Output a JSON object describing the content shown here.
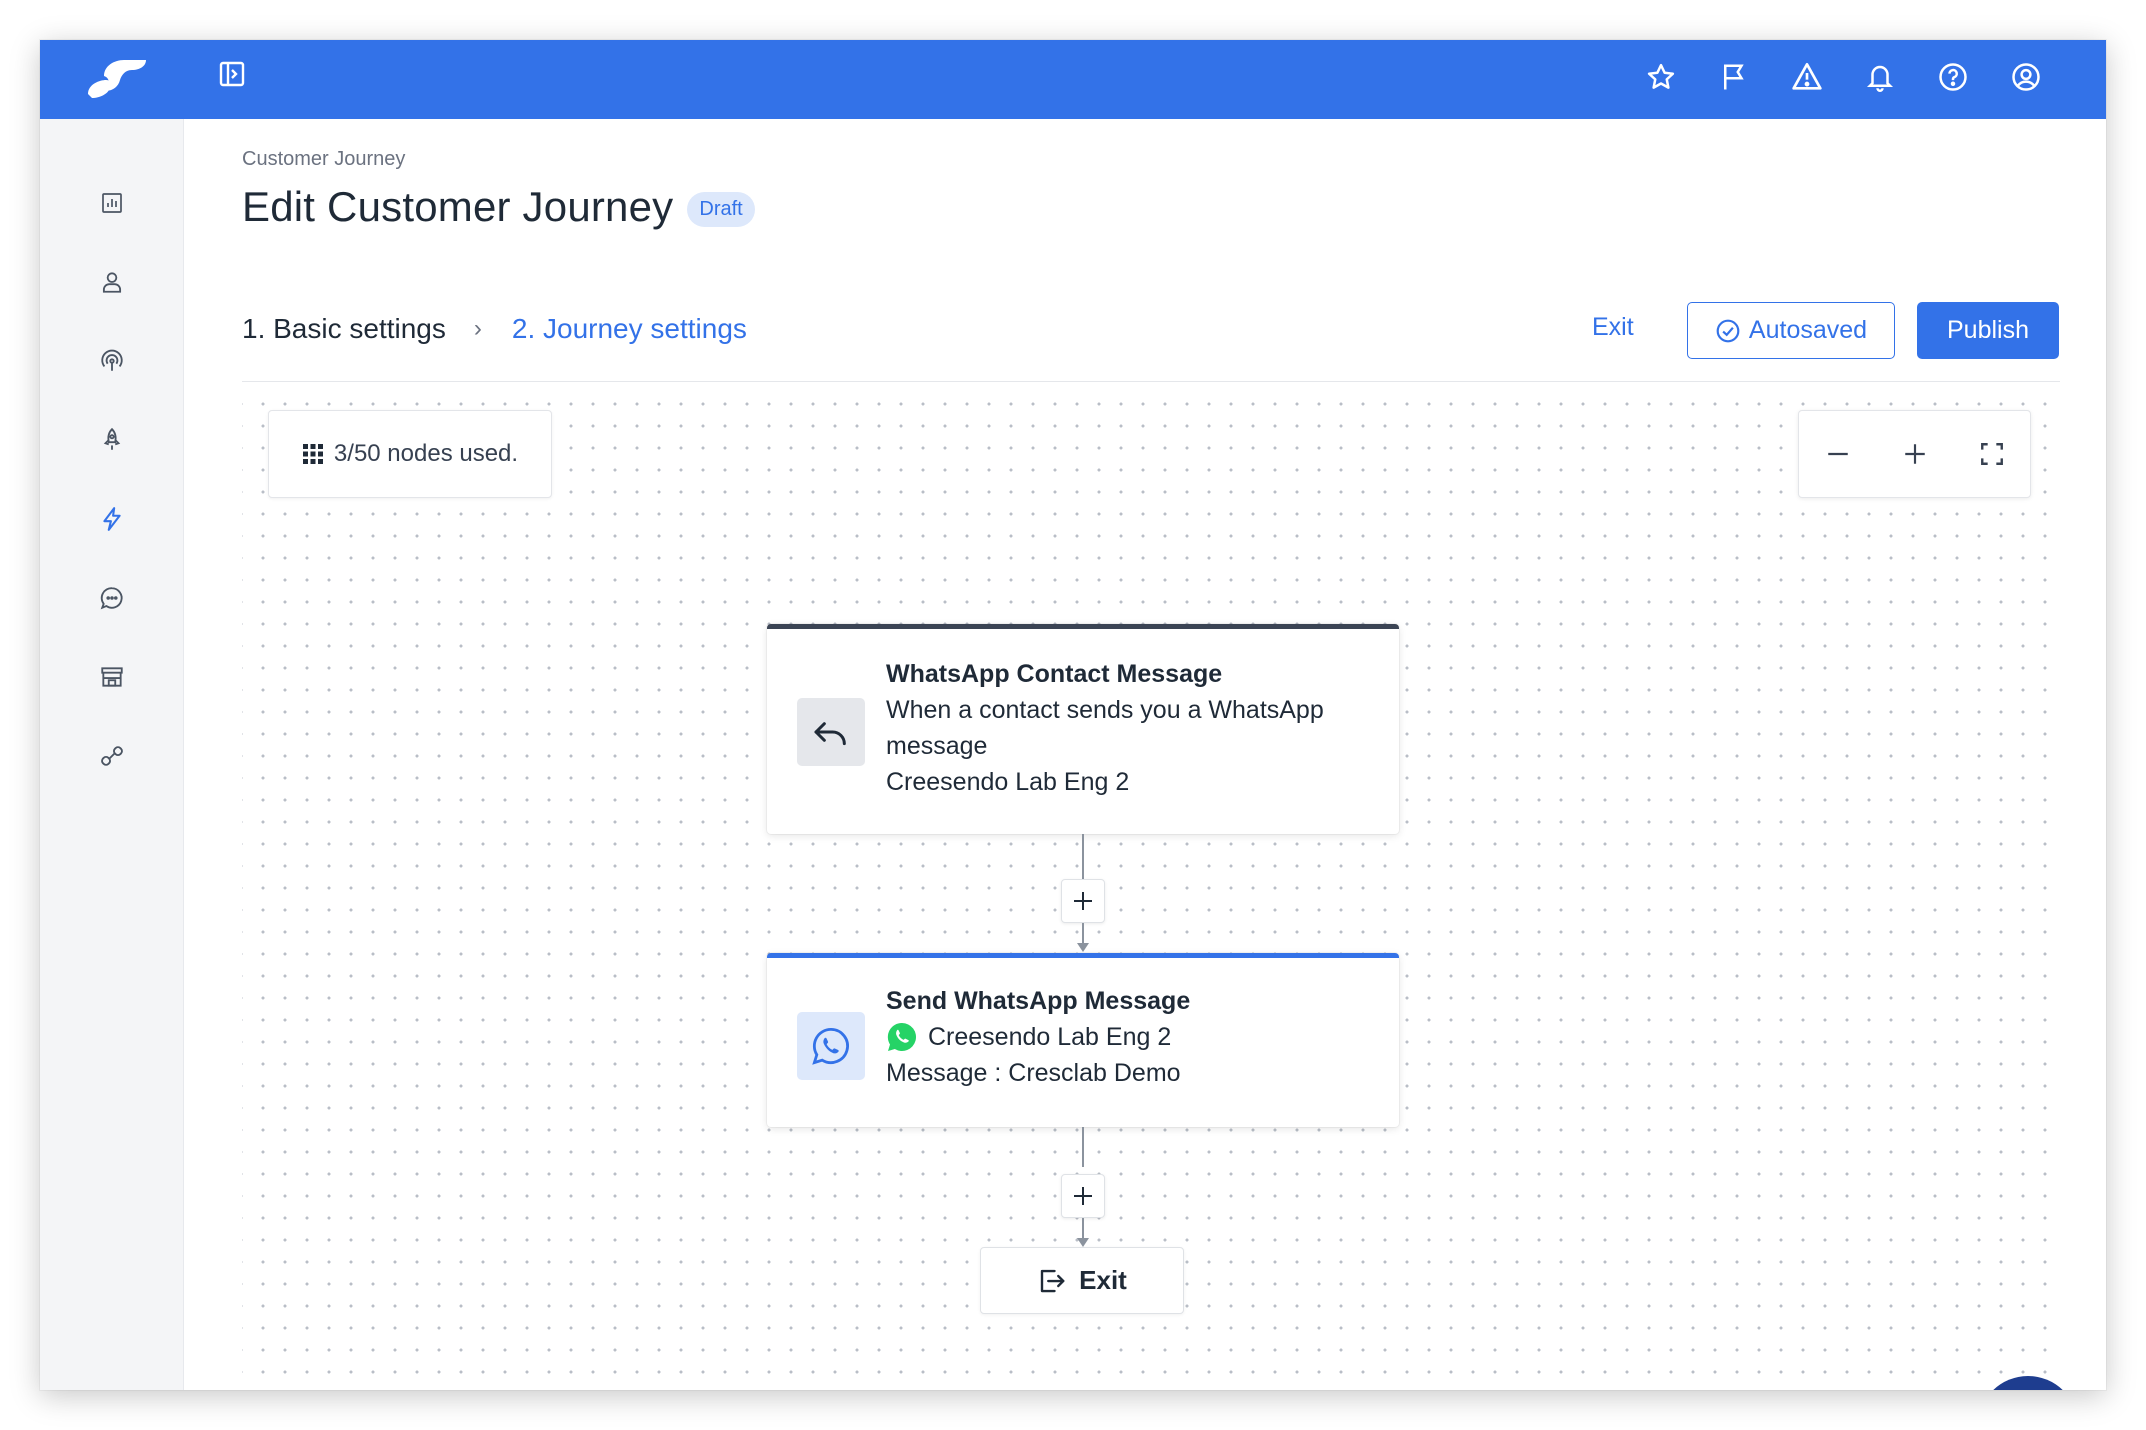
{
  "topbar": {
    "icons": [
      "star-icon",
      "flag-icon",
      "warning-icon",
      "bell-icon",
      "help-icon",
      "account-icon"
    ]
  },
  "sidenav": {
    "items": [
      "analytics-icon",
      "user-icon",
      "broadcast-icon",
      "rocket-icon",
      "lightning-icon",
      "chat-icon",
      "store-icon",
      "integration-icon"
    ],
    "active": "lightning-icon"
  },
  "header": {
    "breadcrumb": "Customer Journey",
    "title": "Edit Customer Journey",
    "badge": "Draft"
  },
  "steps": {
    "step1": "1. Basic settings",
    "separator": "›",
    "step2": "2. Journey settings"
  },
  "actions": {
    "exit": "Exit",
    "autosaved": "Autosaved",
    "publish": "Publish"
  },
  "canvas": {
    "nodes_used": "3/50 nodes used."
  },
  "nodes": {
    "trigger": {
      "title": "WhatsApp Contact Message",
      "description": "When a contact sends you a WhatsApp message",
      "account": "Creesendo Lab Eng 2"
    },
    "action": {
      "title": "Send WhatsApp Message",
      "account": "Creesendo Lab Eng 2",
      "message": "Message : Cresclab Demo"
    },
    "exit": {
      "label": "Exit"
    }
  },
  "colors": {
    "brand": "#3372e8",
    "whatsapp": "#25d366",
    "trigger_accent": "#3b4454"
  }
}
